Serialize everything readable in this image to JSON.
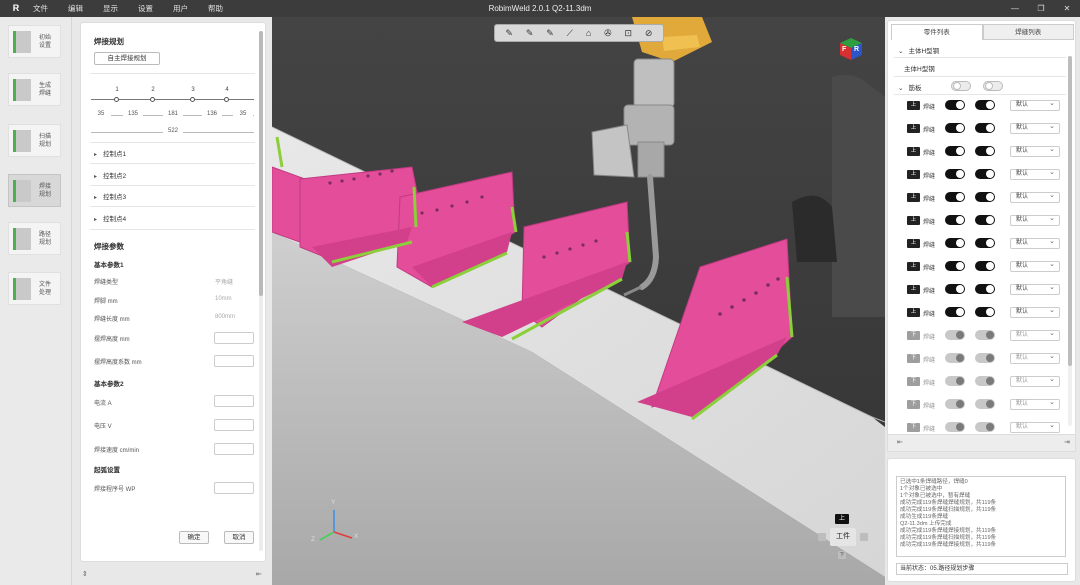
{
  "window": {
    "logo": "R",
    "title": "RobimWeld 2.0.1   Q2-11.3dm",
    "menu": [
      "文件",
      "编辑",
      "显示",
      "设置",
      "用户",
      "帮助"
    ],
    "controls": [
      "—",
      "❐",
      "✕"
    ]
  },
  "sidebar": {
    "items": [
      {
        "label": "初始设置"
      },
      {
        "label": "生成焊缝"
      },
      {
        "label": "扫描规划"
      },
      {
        "label": "焊接规划"
      },
      {
        "label": "路径规划"
      },
      {
        "label": "文件处理"
      }
    ]
  },
  "planning": {
    "title": "焊接规划",
    "plan_button": "自主焊接规划",
    "nodes": [
      "1",
      "2",
      "3",
      "4"
    ],
    "segments": [
      "35",
      "135",
      "181",
      "136",
      "35"
    ],
    "total": "522",
    "points": [
      "控制点1",
      "控制点2",
      "控制点3",
      "控制点4"
    ],
    "params_title": "焊接参数",
    "basic1": "基本参数1",
    "seam_type_label": "焊缝类型",
    "seam_type_value": "平角缝",
    "leg_label": "焊脚 mm",
    "leg_value": "10mm",
    "length_label": "焊缝长度 mm",
    "length_value": "800mm",
    "height_label": "摆焊高度 mm",
    "height_coef_label": "摆焊高度系数 mm",
    "basic2": "基本参数2",
    "current_label": "电流 A",
    "voltage_label": "电压 V",
    "speed_label": "焊接速度 cm/min",
    "start_title": "起弧设置",
    "wp_label": "焊接程序号 WP",
    "ok": "确定",
    "cancel": "取消"
  },
  "left_footer": {
    "left": "⇕",
    "right": "⇤"
  },
  "toolbar3d": {
    "icons": [
      "✎",
      "✎",
      "✎",
      "⟋",
      "⌂",
      "✇",
      "⊡",
      "⊘"
    ]
  },
  "viewcube": {
    "top": "上",
    "front": "F",
    "right": "R"
  },
  "axes": {
    "x": "X",
    "y": "Y",
    "z": "Z"
  },
  "nav": {
    "up": "上",
    "center": "工件",
    "down": "下"
  },
  "parts": {
    "tab_parts": "零件列表",
    "tab_seams": "焊缝列表",
    "group": "主体H型钢",
    "item": "主体H型钢",
    "subgroup": "筋板",
    "rows": [
      {
        "tag": "上",
        "label": "焊缝",
        "a": "on",
        "b": "on",
        "opt": "默认"
      },
      {
        "tag": "上",
        "label": "焊缝",
        "a": "on",
        "b": "on",
        "opt": "默认"
      },
      {
        "tag": "上",
        "label": "焊缝",
        "a": "on",
        "b": "on",
        "opt": "默认"
      },
      {
        "tag": "上",
        "label": "焊缝",
        "a": "on",
        "b": "on",
        "opt": "默认"
      },
      {
        "tag": "上",
        "label": "焊缝",
        "a": "on",
        "b": "on",
        "opt": "默认"
      },
      {
        "tag": "上",
        "label": "焊缝",
        "a": "on",
        "b": "on",
        "opt": "默认"
      },
      {
        "tag": "上",
        "label": "焊缝",
        "a": "on",
        "b": "on",
        "opt": "默认"
      },
      {
        "tag": "上",
        "label": "焊缝",
        "a": "on",
        "b": "on",
        "opt": "默认"
      },
      {
        "tag": "上",
        "label": "焊缝",
        "a": "on",
        "b": "on",
        "opt": "默认"
      },
      {
        "tag": "上",
        "label": "焊缝",
        "a": "on",
        "b": "on",
        "opt": "默认"
      },
      {
        "tag": "下",
        "label": "焊缝",
        "a": "dis",
        "b": "dis",
        "opt": "默认"
      },
      {
        "tag": "下",
        "label": "焊缝",
        "a": "dis",
        "b": "dis",
        "opt": "默认"
      },
      {
        "tag": "下",
        "label": "焊缝",
        "a": "dis",
        "b": "dis",
        "opt": "默认"
      },
      {
        "tag": "下",
        "label": "焊缝",
        "a": "dis",
        "b": "dis",
        "opt": "默认"
      },
      {
        "tag": "下",
        "label": "焊缝",
        "a": "dis",
        "b": "dis",
        "opt": "默认"
      }
    ],
    "footer_left": "⇤",
    "footer_right": "⇥"
  },
  "log": {
    "lines": [
      "已选中1条焊缝路径，焊缝0",
      "1个对象已被选中",
      "1个对象已被选中，暂有焊缝",
      "成功完成119条焊缝焊缝规划，共119条",
      "成功完成119条焊缝扫描规划，共119条",
      "成功生成119条焊缝",
      "Q2-11.3dm 上传完成",
      "成功完成119条焊缝焊接规划，共119条",
      "成功完成119条焊缝扫描规划，共119条",
      "成功完成119条焊缝焊接规划，共119条"
    ],
    "status": "当前状态：05.路径规划步骤"
  }
}
